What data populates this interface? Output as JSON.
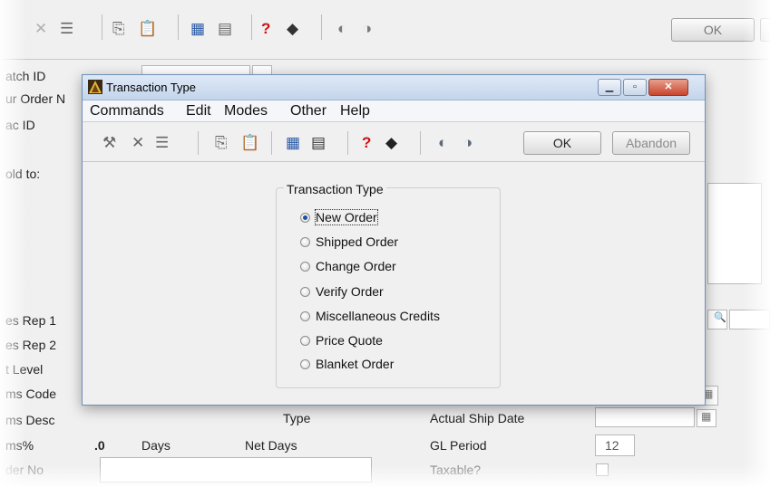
{
  "background": {
    "toolbar": {
      "ok_label": "OK"
    },
    "form": {
      "labels": {
        "batch_id": "atch ID",
        "order_no": "ur Order N",
        "spec_id": "ac ID",
        "sold_to": "old to:",
        "sales_rep_1": "es Rep 1",
        "sales_rep_2": "es Rep 2",
        "price_level": "t Level",
        "terms_code": "ms Code",
        "terms_desc": "ms Desc",
        "terms_pct": "ms%",
        "order_no_bottom": "der No",
        "type": "Type",
        "actual_ship_date": "Actual Ship Date",
        "gl_period": "GL Period",
        "taxable": "Taxable?"
      },
      "values": {
        "terms_pct": ".0",
        "days": "Days",
        "net_days": "Net Days",
        "gl_period": "12"
      }
    }
  },
  "dialog": {
    "title": "Transaction Type",
    "menu": [
      "Commands",
      "Edit",
      "Modes",
      "Other",
      "Help"
    ],
    "toolbar": {
      "ok_label": "OK",
      "abandon_label": "Abandon"
    },
    "group_title": "Transaction Type",
    "options": [
      {
        "label": "New Order",
        "selected": true
      },
      {
        "label": "Shipped Order",
        "selected": false
      },
      {
        "label": "Change Order",
        "selected": false
      },
      {
        "label": "Verify Order",
        "selected": false
      },
      {
        "label": "Miscellaneous Credits",
        "selected": false
      },
      {
        "label": "Price Quote",
        "selected": false
      },
      {
        "label": "Blanket Order",
        "selected": false
      }
    ]
  }
}
